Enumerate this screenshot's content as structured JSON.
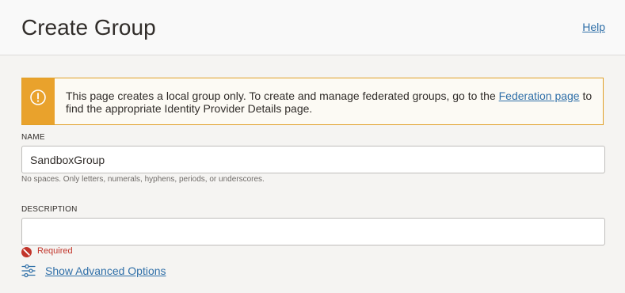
{
  "header": {
    "title": "Create Group",
    "help_label": "Help"
  },
  "banner": {
    "text_before": "This page creates a local group only. To create and manage federated groups, go to the ",
    "link_label": "Federation page",
    "text_after": " to find the appropriate Identity Provider Details page.",
    "icon": "warning-circle-icon",
    "accent_color": "#e9a22c"
  },
  "form": {
    "name": {
      "label": "NAME",
      "value": "SandboxGroup",
      "hint": "No spaces. Only letters, numerals, hyphens, periods, or underscores."
    },
    "description": {
      "label": "DESCRIPTION",
      "value": "",
      "error": "Required",
      "error_color": "#c2352b"
    },
    "advanced_options_label": "Show Advanced Options"
  },
  "colors": {
    "link": "#2f6fa8",
    "background": "#f5f4f2"
  }
}
